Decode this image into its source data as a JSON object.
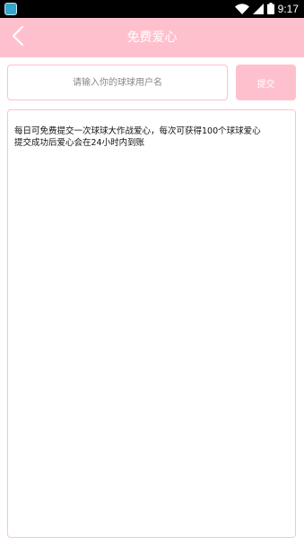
{
  "status_bar": {
    "time": "9:17",
    "icons": [
      "app-notification-icon",
      "wifi-icon",
      "signal-icon",
      "battery-icon"
    ]
  },
  "header": {
    "title": "免费爱心",
    "back_icon": "chevron-left-icon",
    "background_color": "#ffc0cd"
  },
  "form": {
    "username_placeholder": "请输入你的球球用户名",
    "username_value": "",
    "submit_label": "提交"
  },
  "info": {
    "text": "每日可免费提交一次球球大作战爱心，每次可获得100个球球爱心\n提交成功后爱心会在24小时内到账"
  },
  "colors": {
    "accent": "#ffc0cd",
    "status_bar": "#000000"
  }
}
